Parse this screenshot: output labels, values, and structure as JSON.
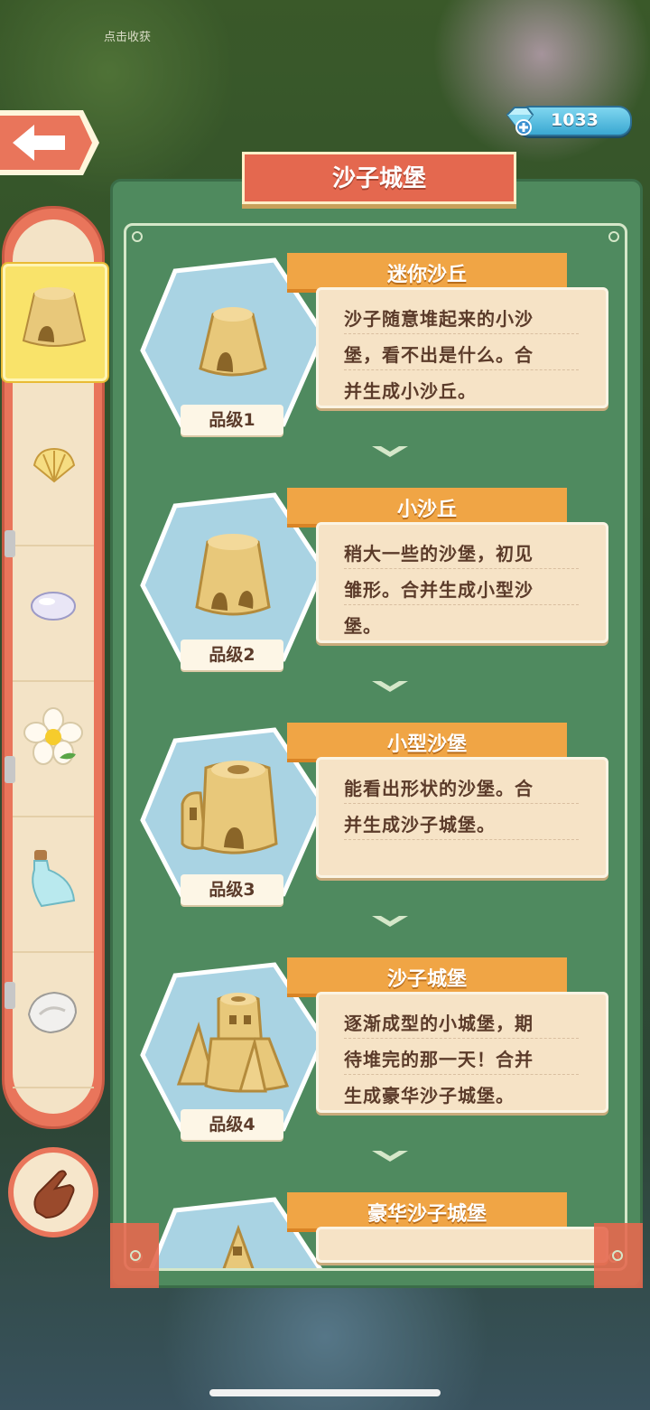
{
  "hud": {
    "harvest_hint": "点击收获",
    "gem_count": "1033",
    "gem_plus_icon": "plus-icon"
  },
  "panel": {
    "title": "沙子城堡"
  },
  "sidebar": {
    "items": [
      {
        "icon": "sand-mound-icon",
        "selected": true
      },
      {
        "icon": "shell-icon",
        "selected": false
      },
      {
        "icon": "pebble-icon",
        "selected": false
      },
      {
        "icon": "flower-icon",
        "selected": false
      },
      {
        "icon": "bottle-icon",
        "selected": false
      },
      {
        "icon": "conch-icon",
        "selected": false
      }
    ]
  },
  "entries": [
    {
      "name": "迷你沙丘",
      "desc_lines": [
        "沙子随意堆起来的小沙",
        "堡，看不出是什么。合",
        "并生成小沙丘。"
      ],
      "grade": "品级1"
    },
    {
      "name": "小沙丘",
      "desc_lines": [
        "稍大一些的沙堡，初见",
        "雏形。合并生成小型沙",
        "堡。"
      ],
      "grade": "品级2"
    },
    {
      "name": "小型沙堡",
      "desc_lines": [
        "能看出形状的沙堡。合",
        "并生成沙子城堡。",
        ""
      ],
      "grade": "品级3"
    },
    {
      "name": "沙子城堡",
      "desc_lines": [
        "逐渐成型的小城堡，期",
        "待堆完的那一天！合并",
        "生成豪华沙子城堡。"
      ],
      "grade": "品级4"
    },
    {
      "name": "豪华沙子城堡",
      "desc_lines": [],
      "grade": ""
    }
  ],
  "colors": {
    "panel_green": "#4f8a5e",
    "title_red": "#e4684f",
    "name_orange": "#f0a545",
    "desc_bg": "#f6e3c6",
    "hex_blue": "#a9d3e3"
  }
}
